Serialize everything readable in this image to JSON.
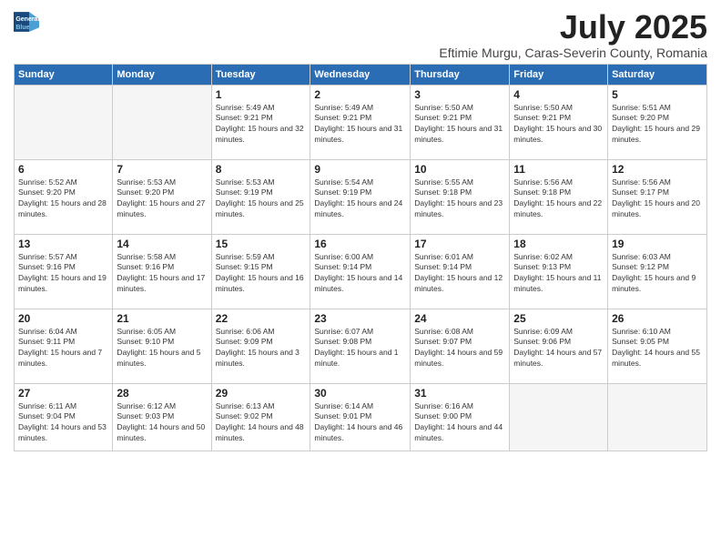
{
  "logo": {
    "line1": "General",
    "line2": "Blue"
  },
  "title": "July 2025",
  "subtitle": "Eftimie Murgu, Caras-Severin County, Romania",
  "days_header": [
    "Sunday",
    "Monday",
    "Tuesday",
    "Wednesday",
    "Thursday",
    "Friday",
    "Saturday"
  ],
  "weeks": [
    [
      {
        "num": "",
        "empty": true
      },
      {
        "num": "",
        "empty": true
      },
      {
        "num": "1",
        "sunrise": "5:49 AM",
        "sunset": "9:21 PM",
        "daylight": "15 hours and 32 minutes."
      },
      {
        "num": "2",
        "sunrise": "5:49 AM",
        "sunset": "9:21 PM",
        "daylight": "15 hours and 31 minutes."
      },
      {
        "num": "3",
        "sunrise": "5:50 AM",
        "sunset": "9:21 PM",
        "daylight": "15 hours and 31 minutes."
      },
      {
        "num": "4",
        "sunrise": "5:50 AM",
        "sunset": "9:21 PM",
        "daylight": "15 hours and 30 minutes."
      },
      {
        "num": "5",
        "sunrise": "5:51 AM",
        "sunset": "9:20 PM",
        "daylight": "15 hours and 29 minutes."
      }
    ],
    [
      {
        "num": "6",
        "sunrise": "5:52 AM",
        "sunset": "9:20 PM",
        "daylight": "15 hours and 28 minutes."
      },
      {
        "num": "7",
        "sunrise": "5:53 AM",
        "sunset": "9:20 PM",
        "daylight": "15 hours and 27 minutes."
      },
      {
        "num": "8",
        "sunrise": "5:53 AM",
        "sunset": "9:19 PM",
        "daylight": "15 hours and 25 minutes."
      },
      {
        "num": "9",
        "sunrise": "5:54 AM",
        "sunset": "9:19 PM",
        "daylight": "15 hours and 24 minutes."
      },
      {
        "num": "10",
        "sunrise": "5:55 AM",
        "sunset": "9:18 PM",
        "daylight": "15 hours and 23 minutes."
      },
      {
        "num": "11",
        "sunrise": "5:56 AM",
        "sunset": "9:18 PM",
        "daylight": "15 hours and 22 minutes."
      },
      {
        "num": "12",
        "sunrise": "5:56 AM",
        "sunset": "9:17 PM",
        "daylight": "15 hours and 20 minutes."
      }
    ],
    [
      {
        "num": "13",
        "sunrise": "5:57 AM",
        "sunset": "9:16 PM",
        "daylight": "15 hours and 19 minutes."
      },
      {
        "num": "14",
        "sunrise": "5:58 AM",
        "sunset": "9:16 PM",
        "daylight": "15 hours and 17 minutes."
      },
      {
        "num": "15",
        "sunrise": "5:59 AM",
        "sunset": "9:15 PM",
        "daylight": "15 hours and 16 minutes."
      },
      {
        "num": "16",
        "sunrise": "6:00 AM",
        "sunset": "9:14 PM",
        "daylight": "15 hours and 14 minutes."
      },
      {
        "num": "17",
        "sunrise": "6:01 AM",
        "sunset": "9:14 PM",
        "daylight": "15 hours and 12 minutes."
      },
      {
        "num": "18",
        "sunrise": "6:02 AM",
        "sunset": "9:13 PM",
        "daylight": "15 hours and 11 minutes."
      },
      {
        "num": "19",
        "sunrise": "6:03 AM",
        "sunset": "9:12 PM",
        "daylight": "15 hours and 9 minutes."
      }
    ],
    [
      {
        "num": "20",
        "sunrise": "6:04 AM",
        "sunset": "9:11 PM",
        "daylight": "15 hours and 7 minutes."
      },
      {
        "num": "21",
        "sunrise": "6:05 AM",
        "sunset": "9:10 PM",
        "daylight": "15 hours and 5 minutes."
      },
      {
        "num": "22",
        "sunrise": "6:06 AM",
        "sunset": "9:09 PM",
        "daylight": "15 hours and 3 minutes."
      },
      {
        "num": "23",
        "sunrise": "6:07 AM",
        "sunset": "9:08 PM",
        "daylight": "15 hours and 1 minute."
      },
      {
        "num": "24",
        "sunrise": "6:08 AM",
        "sunset": "9:07 PM",
        "daylight": "14 hours and 59 minutes."
      },
      {
        "num": "25",
        "sunrise": "6:09 AM",
        "sunset": "9:06 PM",
        "daylight": "14 hours and 57 minutes."
      },
      {
        "num": "26",
        "sunrise": "6:10 AM",
        "sunset": "9:05 PM",
        "daylight": "14 hours and 55 minutes."
      }
    ],
    [
      {
        "num": "27",
        "sunrise": "6:11 AM",
        "sunset": "9:04 PM",
        "daylight": "14 hours and 53 minutes."
      },
      {
        "num": "28",
        "sunrise": "6:12 AM",
        "sunset": "9:03 PM",
        "daylight": "14 hours and 50 minutes."
      },
      {
        "num": "29",
        "sunrise": "6:13 AM",
        "sunset": "9:02 PM",
        "daylight": "14 hours and 48 minutes."
      },
      {
        "num": "30",
        "sunrise": "6:14 AM",
        "sunset": "9:01 PM",
        "daylight": "14 hours and 46 minutes."
      },
      {
        "num": "31",
        "sunrise": "6:16 AM",
        "sunset": "9:00 PM",
        "daylight": "14 hours and 44 minutes."
      },
      {
        "num": "",
        "empty": true
      },
      {
        "num": "",
        "empty": true
      }
    ]
  ]
}
